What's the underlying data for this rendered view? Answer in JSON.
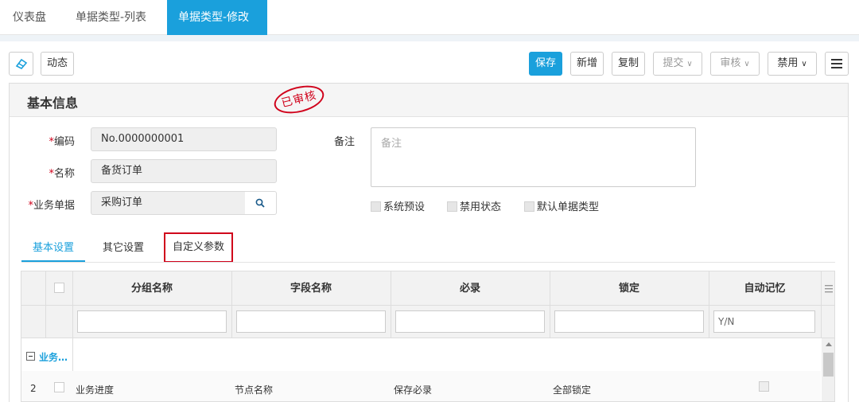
{
  "tabs": [
    {
      "label": "仪表盘"
    },
    {
      "label": "单据类型-列表"
    },
    {
      "label": "单据类型-修改"
    }
  ],
  "toolbar": {
    "dynamic": "动态",
    "save": "保存",
    "new": "新增",
    "copy": "复制",
    "submit": "提交",
    "review": "审核",
    "disable": "禁用"
  },
  "panel": {
    "title": "基本信息",
    "stamp": "已审核"
  },
  "form": {
    "code_label": "编码",
    "code_value": "No.0000000001",
    "name_label": "名称",
    "name_value": "备货订单",
    "biz_label": "业务单据",
    "biz_value": "采购订单",
    "remark_label": "备注",
    "remark_placeholder": "备注",
    "chk_preset": "系统预设",
    "chk_disabled": "禁用状态",
    "chk_default": "默认单据类型"
  },
  "subtabs": [
    "基本设置",
    "其它设置",
    "自定义参数"
  ],
  "grid": {
    "headers": [
      "分组名称",
      "字段名称",
      "必录",
      "锁定",
      "自动记忆"
    ],
    "filter_placeholder_auto": "Y/N",
    "group_label": "业务…",
    "rows": [
      {
        "no": "2",
        "group": "业务进度",
        "field": "节点名称",
        "required": "保存必录",
        "lock": "全部锁定"
      }
    ]
  },
  "colors": {
    "accent": "#1aa0dc",
    "stamp": "#d0021b"
  }
}
